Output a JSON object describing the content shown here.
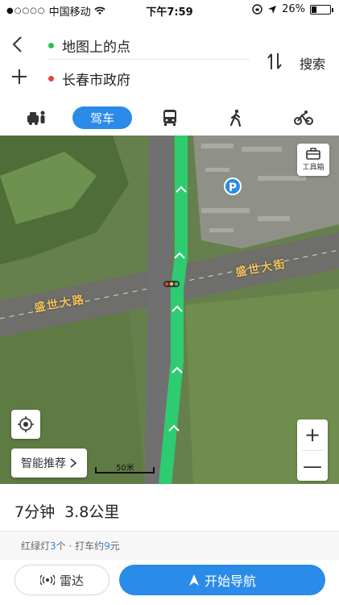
{
  "status_bar": {
    "carrier": "中国移动",
    "time": "下午7:59",
    "battery": "26%",
    "battery_level": 0.26
  },
  "route": {
    "from": "地图上的点",
    "to": "长春市政府",
    "search_label": "搜索"
  },
  "modes": {
    "active_label": "驾车",
    "items": [
      "taxi-icon",
      "car",
      "bus-icon",
      "walk-icon",
      "bike-icon"
    ]
  },
  "map": {
    "toolbox_label": "工具箱",
    "parking_label": "P",
    "road_label_left": "盛世大路",
    "road_label_right": "盛世大街",
    "smart_recommend": "智能推荐",
    "scale_label": "50米",
    "zoom_in": "+",
    "zoom_out": "—"
  },
  "summary": {
    "duration": "7分钟",
    "distance": "3.8公里",
    "traffic_lights_prefix": "红绿灯",
    "traffic_lights_count": "3",
    "traffic_lights_suffix": "个 · 打车约",
    "taxi_fare": "9",
    "taxi_fare_suffix": "元"
  },
  "actions": {
    "radar": "雷达",
    "start_nav": "开始导航"
  },
  "colors": {
    "accent": "#2a8be8",
    "route": "#2ecc71",
    "start_dot": "#2fbf58",
    "end_dot": "#e8423c"
  }
}
